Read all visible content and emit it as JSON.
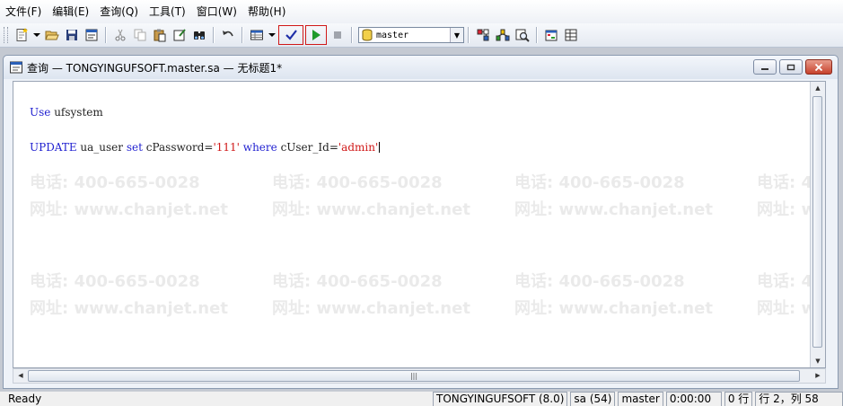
{
  "menu": {
    "items": [
      "文件(F)",
      "编辑(E)",
      "查询(Q)",
      "工具(T)",
      "窗口(W)",
      "帮助(H)"
    ]
  },
  "toolbar": {
    "database_selected": "master",
    "icons": [
      "new-query-icon",
      "dropdown-arrow-icon",
      "open-file-icon",
      "save-icon",
      "load-script-icon",
      "cut-icon",
      "copy-icon",
      "paste-icon",
      "clear-window-icon",
      "find-icon",
      "undo-icon",
      "results-grid-icon",
      "dropdown-arrow-icon",
      "check-syntax-icon",
      "execute-icon",
      "stop-icon",
      "database-icon",
      "display-plan-icon",
      "show-trace-icon",
      "index-analysis-icon",
      "object-browser-icon",
      "results-pane-icon"
    ]
  },
  "query_window": {
    "title": "查询 — TONGYINGUFSOFT.master.sa — 无标题1*",
    "code_line1": {
      "kw": "Use",
      "id": " ufsystem"
    },
    "code_line2": {
      "kw_update": "UPDATE",
      "tbl": " ua_user ",
      "kw_set": "set",
      "col": " cPassword=",
      "val1": "'111'",
      "sp": " ",
      "kw_where": "where",
      "col2": " cUser_Id=",
      "val2": "'admin'"
    }
  },
  "watermark": {
    "phone": "电话: 400-665-0028",
    "site": "网址: www.chanjet.net"
  },
  "status": {
    "ready": "Ready",
    "server": "TONGYINGUFSOFT (8.0)",
    "user": "sa (54)",
    "db": "master",
    "time": "0:00:00",
    "rows": "0 行",
    "position": "行 2，列 58"
  },
  "colors": {
    "keyword": "#1f1fd0",
    "string": "#d01818",
    "highlight_border": "#d01818",
    "close_button": "#c7422c"
  }
}
